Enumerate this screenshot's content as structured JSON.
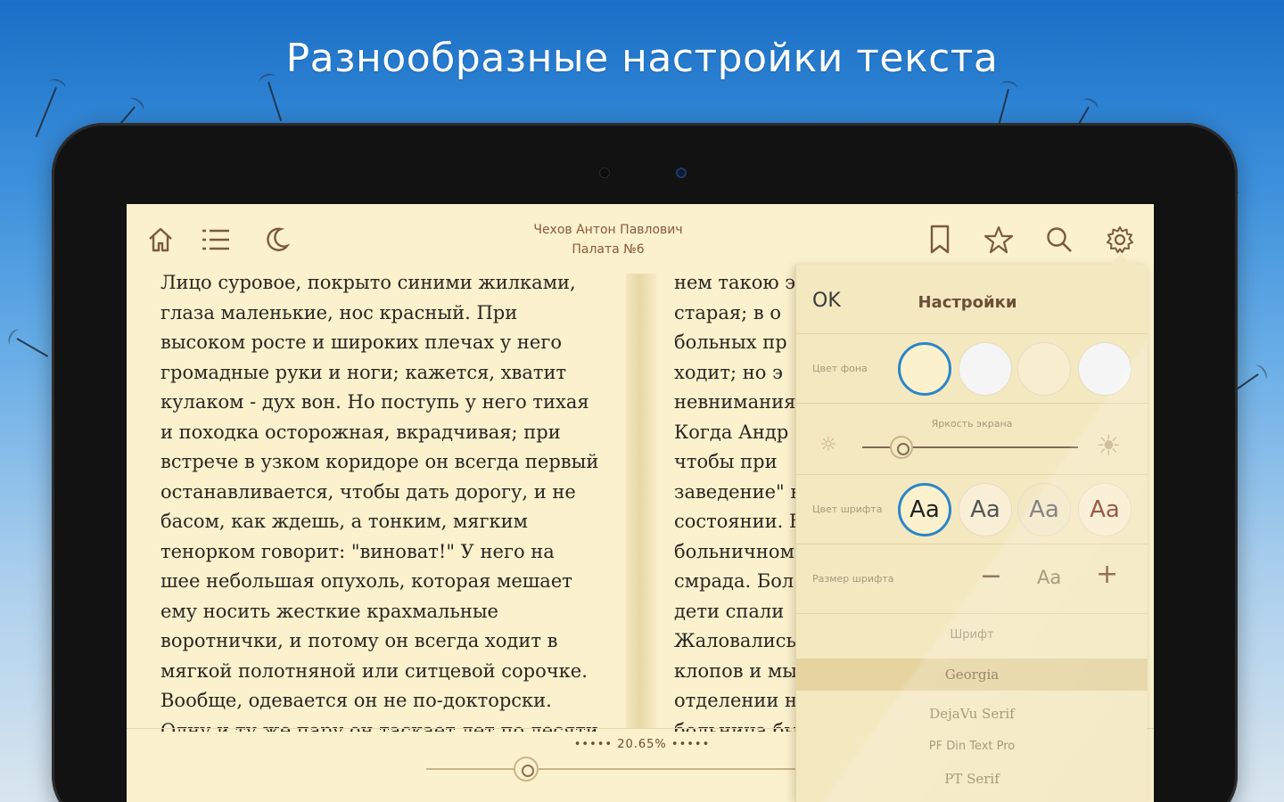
{
  "headline": "Разнообразные настройки текста",
  "toolbar": {
    "home_icon": "home-icon",
    "toc_icon": "list-icon",
    "night_icon": "moon-icon",
    "bookmark_icon": "bookmark-icon",
    "favorite_icon": "star-icon",
    "search_icon": "search-icon",
    "settings_icon": "gear-icon"
  },
  "book": {
    "author": "Чехов Антон Павлович",
    "title": "Палата №6"
  },
  "page_left": [
    "Лицо суровое, покрыто синими жилками,",
    "глаза маленькие, нос красный. При",
    "высоком росте и широких плечах у него",
    "громадные руки и ноги; кажется, хватит",
    "кулаком - дух вон. Но поступь у него тихая",
    "и походка осторожная, вкрадчивая; при",
    "встрече в узком коридоре он всегда первый",
    "останавливается, чтобы дать дорогу, и не",
    "басом, как ждешь, а тонким, мягким",
    "тенорком говорит: \"виноват!\" У него на",
    "шее небольшая опухоль, которая мешает",
    "ему носить жесткие крахмальные",
    "воротнички, и потому он всегда ходит в",
    "мягкой полотняной или ситцевой сорочке.",
    "Вообще, одевается он не по-докторски.",
    "Одну и ту же пару он таскает лет по десяти"
  ],
  "page_right": [
    "нем такою э",
    "старая; в о",
    "больных пр",
    "ходит; но э",
    "невнимания",
    "Когда Андр",
    "чтобы при",
    "заведение\" в",
    "состоянии. Б",
    "больничном",
    "смрада. Бол",
    "дети спали",
    "Жаловались",
    "клопов и мы",
    "отделении н",
    "больница бы"
  ],
  "progress": {
    "label": "••••• 20.65% •••••",
    "fraction": 0.2065
  },
  "settings": {
    "ok": "OK",
    "title": "Настройки",
    "bg_color_label": "Цвет фона",
    "bg_colors": [
      "#fbf1cd",
      "#f5f5f5",
      "#f8edcf",
      "#f5f5f5"
    ],
    "bg_selected": 0,
    "brightness_label": "Яркость экрана",
    "brightness": 0.18,
    "font_color_label": "Цвет шрифта",
    "font_sample": "Aa",
    "font_colors": [
      {
        "bg": "#fbf1cd",
        "fg": "#222222"
      },
      {
        "bg": "#f8efd6",
        "fg": "#555555"
      },
      {
        "bg": "#f3e7c4",
        "fg": "#6b6b6b"
      },
      {
        "bg": "#f8edcf",
        "fg": "#8a3b22"
      }
    ],
    "font_color_selected": 0,
    "font_size_label": "Размер шрифта",
    "font_size_minus": "−",
    "font_size_sample": "Aa",
    "font_size_plus": "+",
    "font_label": "Шрифт",
    "fonts": [
      "Georgia",
      "DejaVu Serif",
      "PF Din Text Pro",
      "PT Serif"
    ],
    "font_selected": 0
  },
  "colors": {
    "accent": "#2b86c8",
    "paper": "#fbf1cd",
    "brown": "#7b5b3c"
  }
}
